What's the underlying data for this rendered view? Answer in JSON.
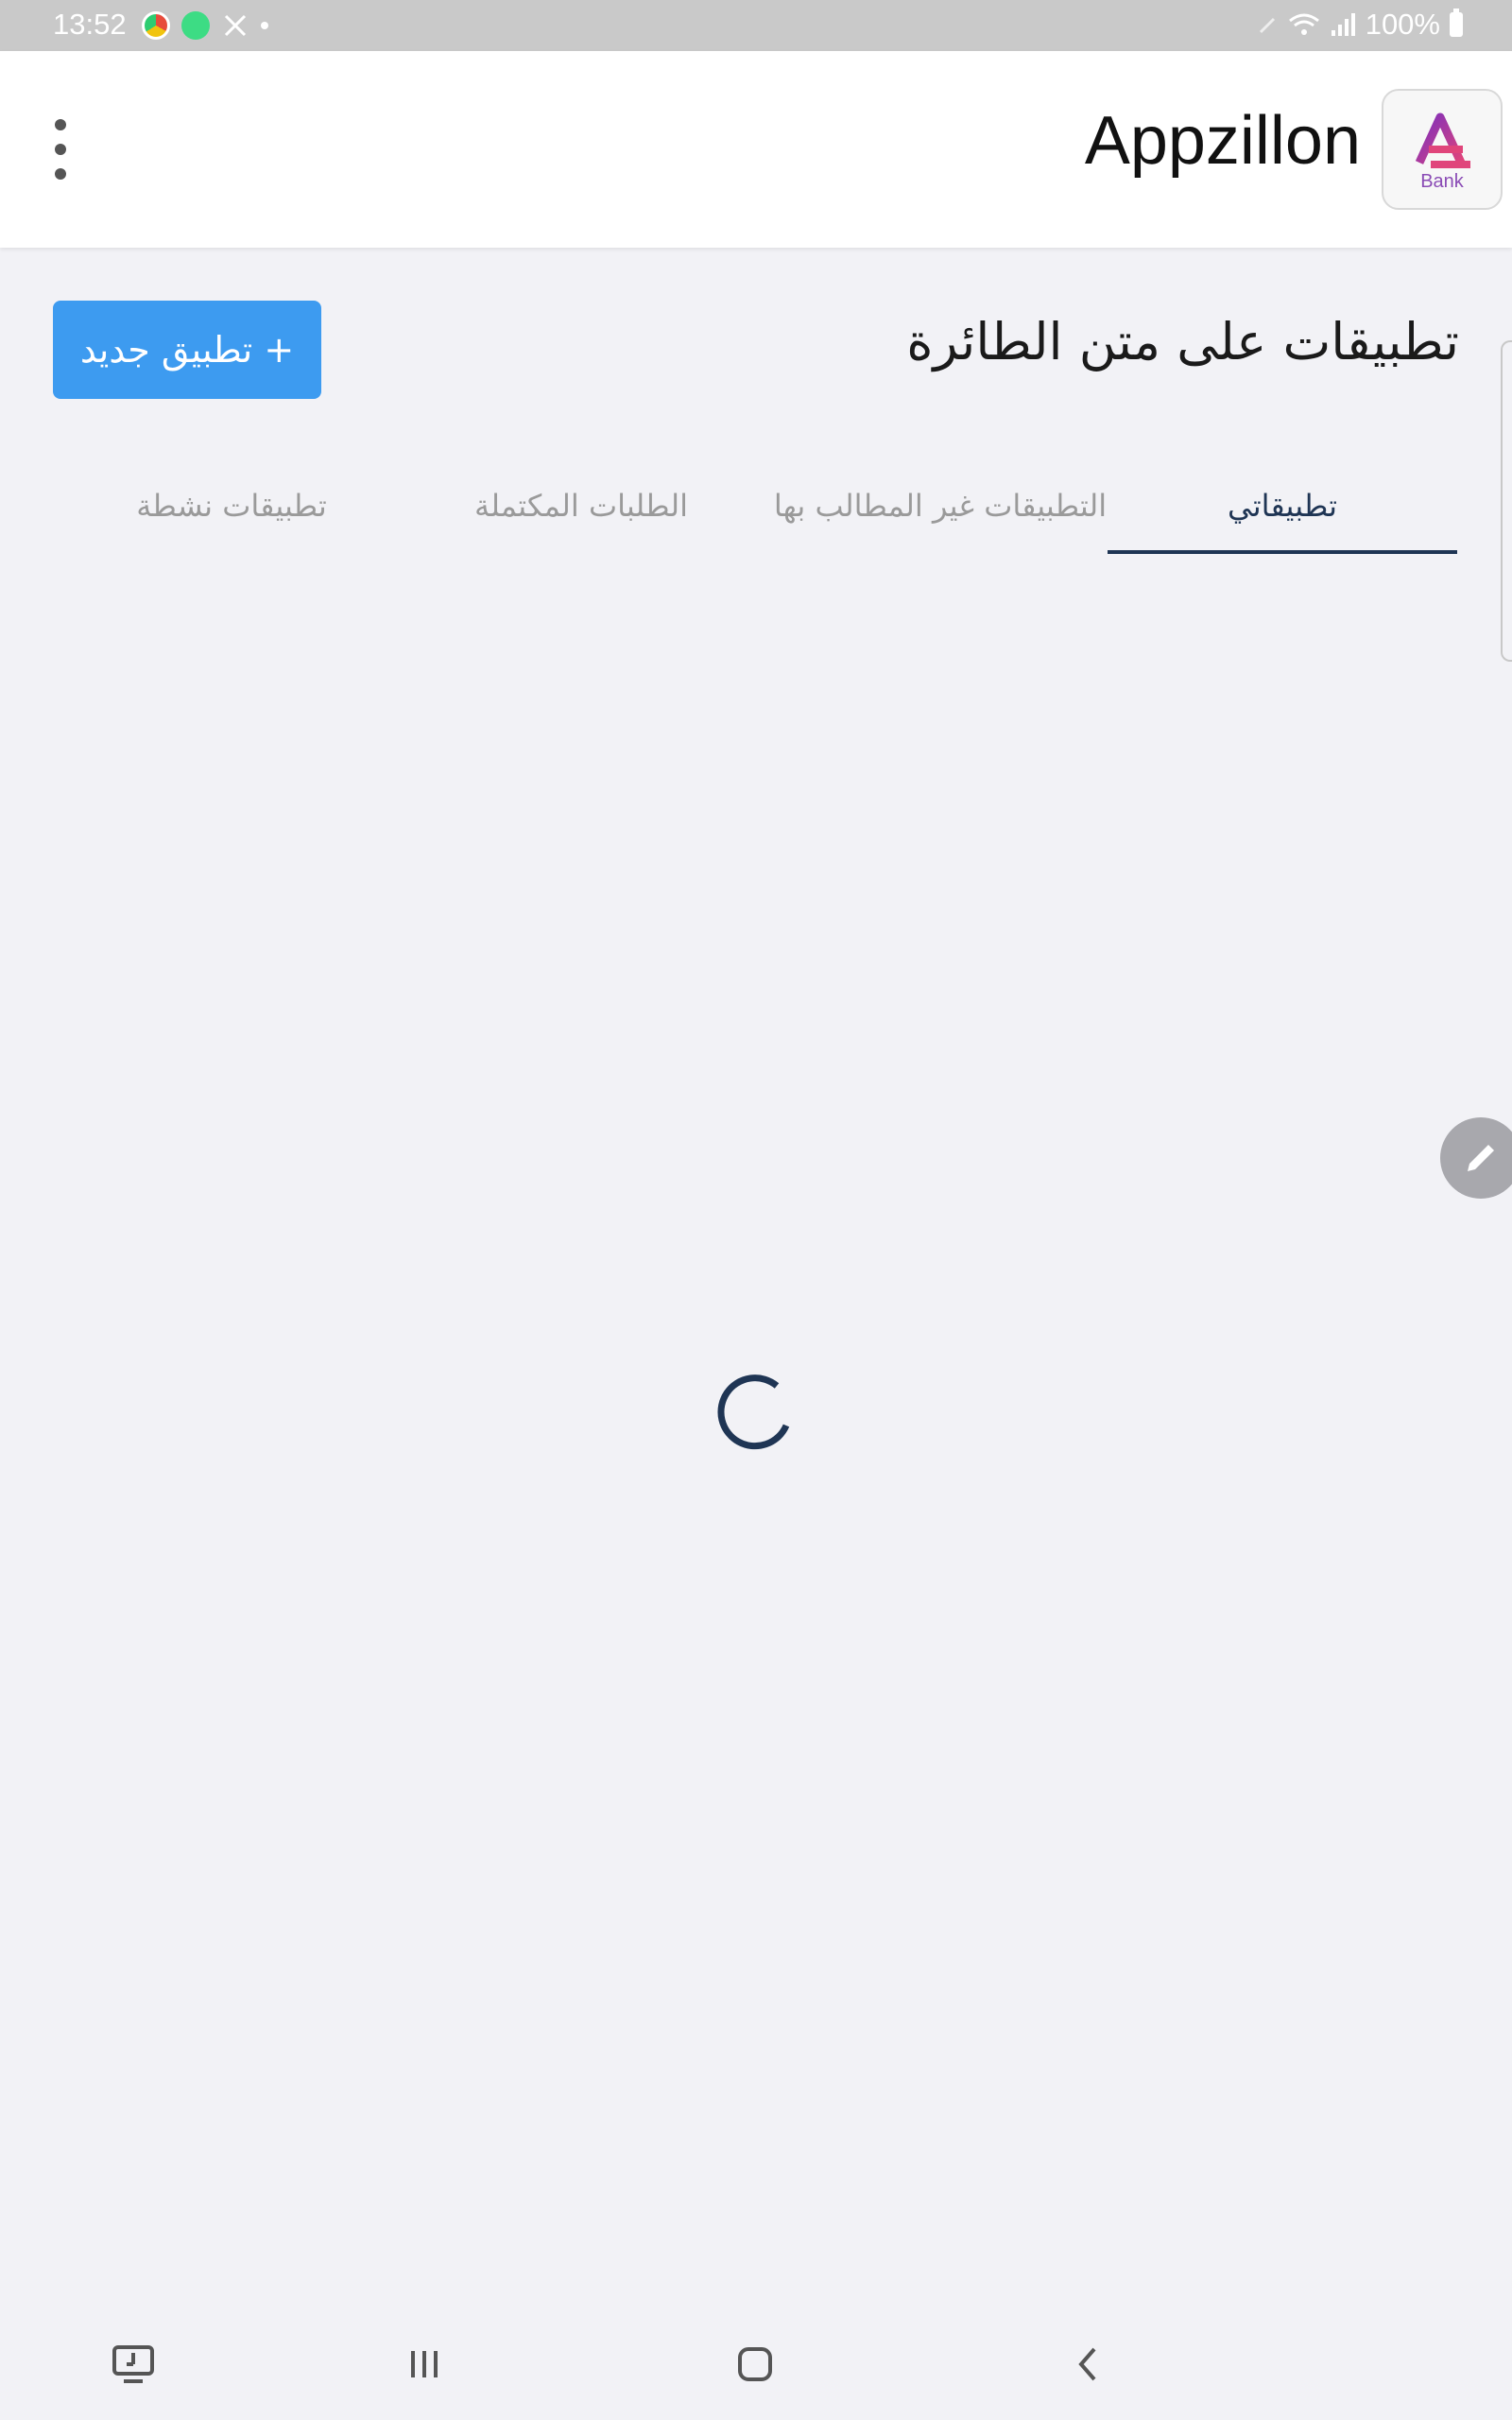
{
  "status_bar": {
    "time": "13:52",
    "battery": "100%"
  },
  "app_bar": {
    "title": "Appzillon",
    "logo_caption": "Bank",
    "menu_icon": "more-vert-icon"
  },
  "page": {
    "title": "تطبيقات على متن الطائرة",
    "new_button_label": "+ تطبيق جديد"
  },
  "tabs": [
    {
      "label": "تطبيقاتي",
      "active": true
    },
    {
      "label": "التطبيقات غير المطالب بها",
      "active": false
    },
    {
      "label": "الطلبات المكتملة",
      "active": false
    },
    {
      "label": "تطبيقات نشطة",
      "active": false
    }
  ],
  "colors": {
    "accent": "#3d9bf0",
    "tab_active": "#1f3554",
    "background": "#f2f2f6"
  },
  "loading": true,
  "nav_bar": {
    "icons": [
      "screen-cast-icon",
      "recents-icon",
      "home-icon",
      "back-icon"
    ]
  }
}
